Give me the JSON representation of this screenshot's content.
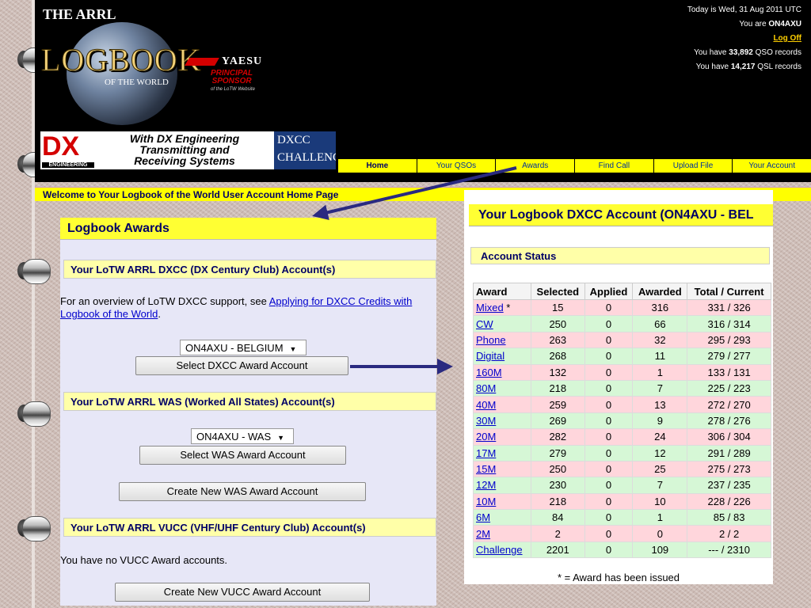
{
  "header": {
    "brand_top": "THE ARRL",
    "brand_main": "LOGBOOK",
    "brand_sub": "OF THE WORLD",
    "yaesu": "YAESU",
    "sponsor_line1": "PRINCIPAL",
    "sponsor_line2": "SPONSOR",
    "sponsor_sub": "of the LoTW Website",
    "dx_banner_line1": "With DX Engineering",
    "dx_banner_line2": "Transmitting and",
    "dx_banner_line3": "Receiving Systems",
    "dx_logo_text": "DX",
    "dx_logo_sub": "ENGINEERING",
    "dxcc_line1": "DXCC",
    "dxcc_line2": "CHALLENGE"
  },
  "user_info": {
    "today": "Today is Wed, 31 Aug 2011 UTC",
    "you_are_prefix": "You are ",
    "callsign": "ON4AXU",
    "logoff": "Log Off",
    "qso_prefix": "You have ",
    "qso_count": "33,892",
    "qso_suffix": " QSO records",
    "qsl_prefix": "You have ",
    "qsl_count": "14,217",
    "qsl_suffix": " QSL records"
  },
  "nav": [
    "Home",
    "Your QSOs",
    "Awards",
    "Find Call",
    "Upload File",
    "Your Account"
  ],
  "welcome": "Welcome to Your Logbook of the World User Account Home Page",
  "left": {
    "title": "Logbook Awards",
    "dxcc_title": "Your LoTW ARRL DXCC (DX Century Club) Account(s)",
    "dxcc_text": "For an overview of LoTW DXCC support, see ",
    "dxcc_link": "Applying for DXCC Credits with Logbook of the World",
    "dxcc_text_end": ".",
    "dxcc_select": "ON4AXU - BELGIUM",
    "dxcc_button": "Select DXCC Award Account",
    "was_title": "Your LoTW ARRL WAS (Worked All States) Account(s)",
    "was_select": "ON4AXU - WAS",
    "was_button": "Select WAS Award Account",
    "was_create": "Create New WAS Award Account",
    "vucc_title": "Your LoTW ARRL VUCC (VHF/UHF Century Club) Account(s)",
    "vucc_text": "You have no VUCC Award accounts.",
    "vucc_create": "Create New VUCC Award Account"
  },
  "right": {
    "title": "Your Logbook DXCC Account (ON4AXU - BEL",
    "status_title": "Account Status",
    "columns": [
      "Award",
      "Selected",
      "Applied",
      "Awarded",
      "Total / Current"
    ],
    "rows": [
      {
        "award": "Mixed",
        "mark": " *",
        "selected": "15",
        "applied": "0",
        "awarded": "316",
        "total": "331 / 326",
        "color": "pink"
      },
      {
        "award": "CW",
        "mark": "",
        "selected": "250",
        "applied": "0",
        "awarded": "66",
        "total": "316 / 314",
        "color": "green"
      },
      {
        "award": "Phone",
        "mark": "",
        "selected": "263",
        "applied": "0",
        "awarded": "32",
        "total": "295 / 293",
        "color": "pink"
      },
      {
        "award": "Digital",
        "mark": "",
        "selected": "268",
        "applied": "0",
        "awarded": "11",
        "total": "279 / 277",
        "color": "green"
      },
      {
        "award": "160M",
        "mark": "",
        "selected": "132",
        "applied": "0",
        "awarded": "1",
        "total": "133 / 131",
        "color": "pink"
      },
      {
        "award": "80M",
        "mark": "",
        "selected": "218",
        "applied": "0",
        "awarded": "7",
        "total": "225 / 223",
        "color": "green"
      },
      {
        "award": "40M",
        "mark": "",
        "selected": "259",
        "applied": "0",
        "awarded": "13",
        "total": "272 / 270",
        "color": "pink"
      },
      {
        "award": "30M",
        "mark": "",
        "selected": "269",
        "applied": "0",
        "awarded": "9",
        "total": "278 / 276",
        "color": "green"
      },
      {
        "award": "20M",
        "mark": "",
        "selected": "282",
        "applied": "0",
        "awarded": "24",
        "total": "306 / 304",
        "color": "pink"
      },
      {
        "award": "17M",
        "mark": "",
        "selected": "279",
        "applied": "0",
        "awarded": "12",
        "total": "291 / 289",
        "color": "green"
      },
      {
        "award": "15M",
        "mark": "",
        "selected": "250",
        "applied": "0",
        "awarded": "25",
        "total": "275 / 273",
        "color": "pink"
      },
      {
        "award": "12M",
        "mark": "",
        "selected": "230",
        "applied": "0",
        "awarded": "7",
        "total": "237 / 235",
        "color": "green"
      },
      {
        "award": "10M",
        "mark": "",
        "selected": "218",
        "applied": "0",
        "awarded": "10",
        "total": "228 / 226",
        "color": "pink"
      },
      {
        "award": "6M",
        "mark": "",
        "selected": "84",
        "applied": "0",
        "awarded": "1",
        "total": "85 / 83",
        "color": "green"
      },
      {
        "award": "2M",
        "mark": "",
        "selected": "2",
        "applied": "0",
        "awarded": "0",
        "total": "2 / 2",
        "color": "pink"
      },
      {
        "award": "Challenge",
        "mark": "",
        "selected": "2201",
        "applied": "0",
        "awarded": "109",
        "total": "--- / 2310",
        "color": "green"
      }
    ],
    "footnote": "* = Award has been issued"
  },
  "colors": {
    "header_bg": "#000000",
    "nav_yellow": "#ffff00",
    "title_yellow": "#ffff33",
    "section_yellow": "#ffffa8",
    "row_pink": "#ffd6dc",
    "row_green": "#d6f7d6",
    "link_blue": "#0000cc",
    "arrow": "#2a2a80"
  }
}
